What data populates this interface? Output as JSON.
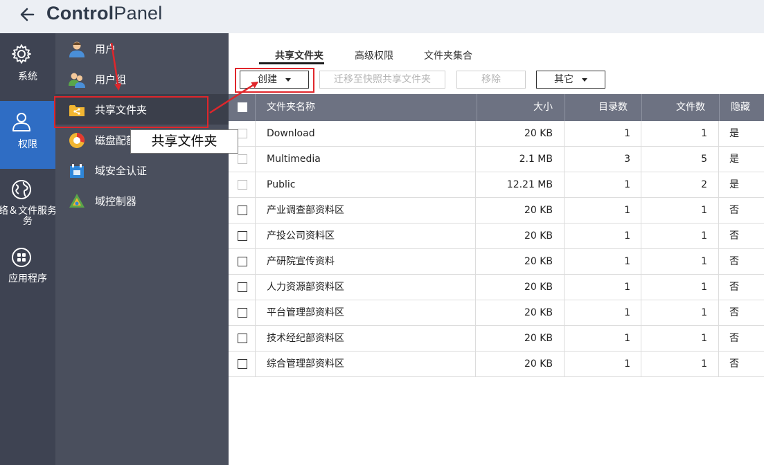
{
  "app": {
    "title_bold": "Control",
    "title_light": "Panel"
  },
  "rail": [
    {
      "label": "系统",
      "icon": "gear-icon"
    },
    {
      "label": "权限",
      "icon": "user-icon",
      "active": true
    },
    {
      "label": "络＆文件服务",
      "label2": "务",
      "icon": "globe-icon"
    },
    {
      "label": "应用程序",
      "icon": "apps-grid-icon"
    }
  ],
  "subnav": [
    {
      "label": "用户",
      "icon": "user-avatar-icon"
    },
    {
      "label": "用户组",
      "icon": "user-group-icon"
    },
    {
      "label": "共享文件夹",
      "icon": "shared-folder-icon",
      "active": true
    },
    {
      "label": "磁盘配额",
      "icon": "disk-quota-icon"
    },
    {
      "label": "域安全认证",
      "icon": "domain-security-icon"
    },
    {
      "label": "域控制器",
      "icon": "domain-controller-icon"
    }
  ],
  "tabs": [
    {
      "label": "共享文件夹",
      "active": true
    },
    {
      "label": "高级权限"
    },
    {
      "label": "文件夹集合"
    }
  ],
  "toolbar": {
    "create": "创建",
    "migrate": "迁移至快照共享文件夹",
    "remove": "移除",
    "other": "其它"
  },
  "table": {
    "columns": [
      "文件夹名称",
      "大小",
      "目录数",
      "文件数",
      "隐藏"
    ],
    "rows": [
      {
        "name": "Download",
        "size": "20 KB",
        "dirs": "1",
        "files": "1",
        "hidden": "是"
      },
      {
        "name": "Multimedia",
        "size": "2.1 MB",
        "dirs": "3",
        "files": "5",
        "hidden": "是"
      },
      {
        "name": "Public",
        "size": "12.21 MB",
        "dirs": "1",
        "files": "2",
        "hidden": "是"
      },
      {
        "name": "产业调查部资料区",
        "size": "20 KB",
        "dirs": "1",
        "files": "1",
        "hidden": "否"
      },
      {
        "name": "产投公司资料区",
        "size": "20 KB",
        "dirs": "1",
        "files": "1",
        "hidden": "否"
      },
      {
        "name": "产研院宣传资料",
        "size": "20 KB",
        "dirs": "1",
        "files": "1",
        "hidden": "否"
      },
      {
        "name": "人力资源部资料区",
        "size": "20 KB",
        "dirs": "1",
        "files": "1",
        "hidden": "否"
      },
      {
        "name": "平台管理部资料区",
        "size": "20 KB",
        "dirs": "1",
        "files": "1",
        "hidden": "否"
      },
      {
        "name": "技术经纪部资料区",
        "size": "20 KB",
        "dirs": "1",
        "files": "1",
        "hidden": "否"
      },
      {
        "name": "综合管理部资料区",
        "size": "20 KB",
        "dirs": "1",
        "files": "1",
        "hidden": "否"
      }
    ]
  },
  "tooltip": "共享文件夹",
  "colors": {
    "rail_bg": "#3e4352",
    "rail_active": "#2f6dc4",
    "subnav_bg": "#4a4f5d",
    "table_header": "#6d7282",
    "annotation_red": "#e0262b"
  }
}
